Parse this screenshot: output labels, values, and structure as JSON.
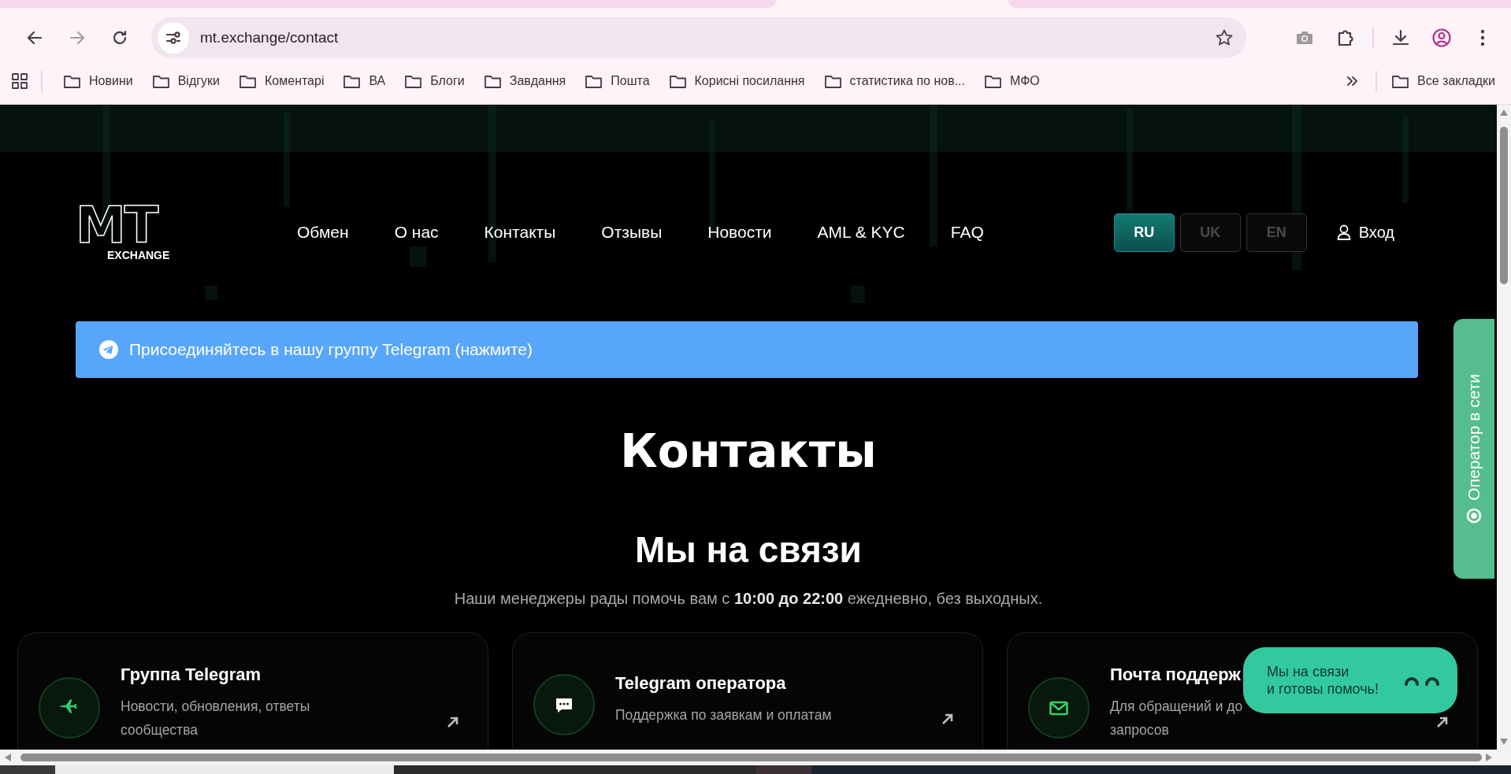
{
  "browser": {
    "url": "mt.exchange/contact",
    "bookmarks": [
      "Новини",
      "Відгуки",
      "Коментарі",
      "ВА",
      "Блоги",
      "Завдання",
      "Пошта",
      "Корисні посилання",
      "статистика по нов...",
      "МФО"
    ],
    "all_bookmarks": "Все закладки"
  },
  "header": {
    "logo": {
      "mark": "MT",
      "word": "EXCHANGE"
    },
    "nav": [
      "Обмен",
      "О нас",
      "Контакты",
      "Отзывы",
      "Новости",
      "AML & KYC",
      "FAQ"
    ],
    "languages": [
      {
        "label": "RU",
        "selected": true
      },
      {
        "label": "UK",
        "selected": false
      },
      {
        "label": "EN",
        "selected": false
      }
    ],
    "login": "Вход"
  },
  "banner": {
    "text": "Присоединяйтесь в нашу группу Telegram (нажмите)"
  },
  "title": "Контакты",
  "subtitle": "Мы на связи",
  "intro": "Наши менеджеры рады помочь вам с **10:00 до 22:00** ежедневно, без выходных.",
  "cards": [
    {
      "kind": "plane",
      "title": "Группа Telegram",
      "description_lines": [
        "Новости, обновления, ответы",
        "сообщества"
      ]
    },
    {
      "kind": "chat",
      "title": "Telegram оператора",
      "description_lines": [
        "Поддержка по заявкам и оплатам"
      ]
    },
    {
      "kind": "mail",
      "title": "Почта поддерж",
      "description_lines": [
        "Для обращений и до",
        "запросов"
      ]
    }
  ],
  "operator_tab": {
    "label": "Оператор в сети"
  },
  "chat_bubble": {
    "lines": [
      "Мы на связи",
      "и готовы помочь!"
    ]
  }
}
